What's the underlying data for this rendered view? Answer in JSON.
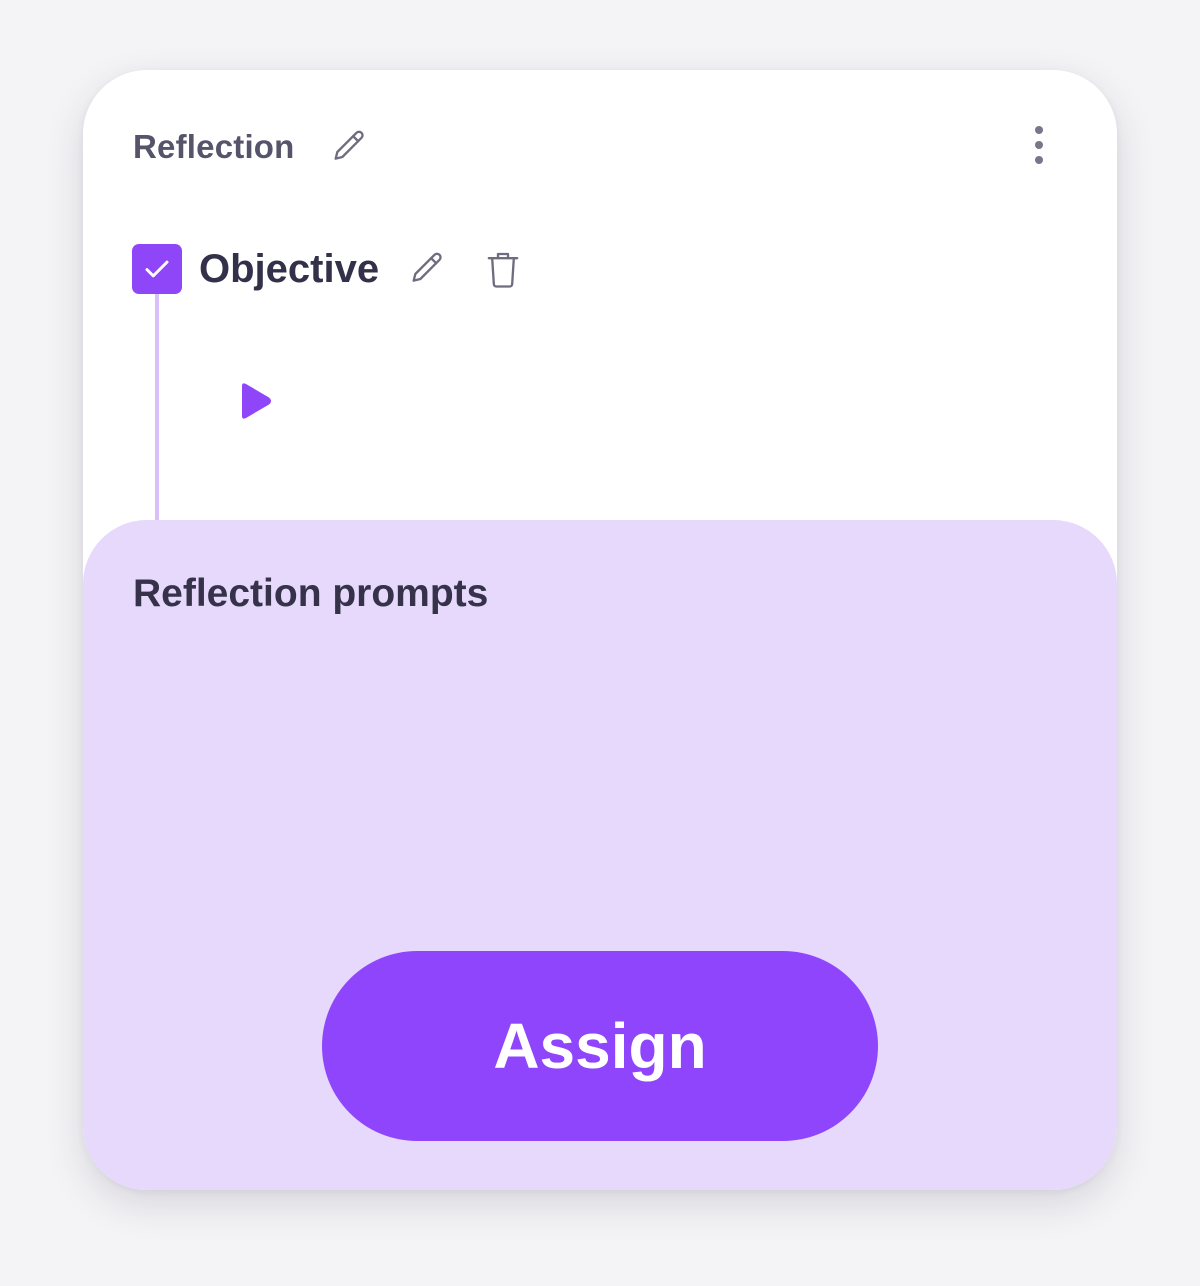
{
  "card": {
    "title": "Reflection",
    "edit_icon": "pencil-icon",
    "more_icon": "more-vertical-icon"
  },
  "objective": {
    "label": "Objective",
    "checked": true,
    "check_icon": "checkmark-icon",
    "edit_icon": "pencil-icon",
    "delete_icon": "trash-icon",
    "play_icon": "play-icon"
  },
  "prompts": {
    "title": "Reflection prompts"
  },
  "actions": {
    "assign_label": "Assign"
  },
  "colors": {
    "accent": "#8f45fc",
    "panel_background": "#e6d9fc",
    "timeline": "#d9c0fb",
    "heading_text": "#33314a",
    "muted_text": "#55546a"
  }
}
